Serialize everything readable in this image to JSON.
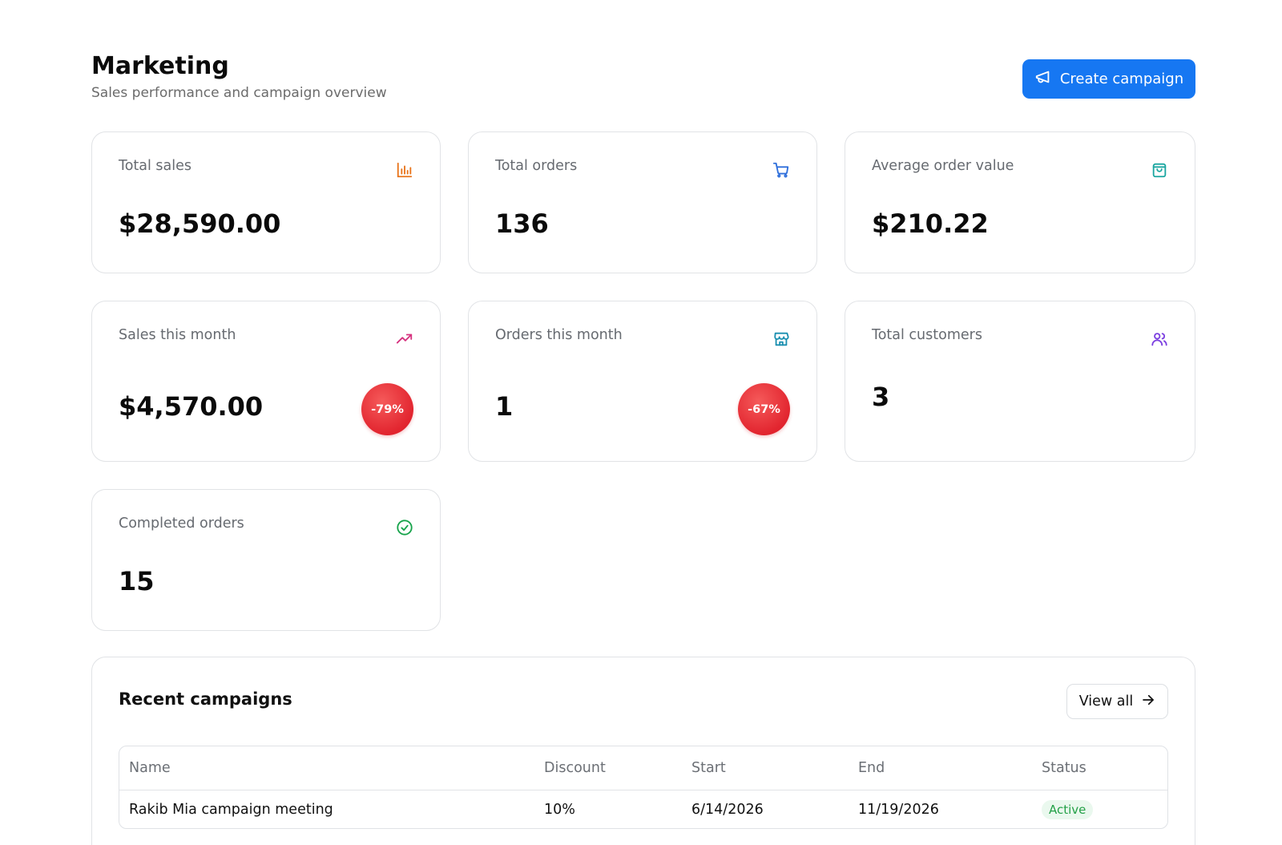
{
  "header": {
    "title": "Marketing",
    "subtitle": "Sales performance and campaign overview",
    "create_button_label": "Create campaign"
  },
  "stats": {
    "total_sales": {
      "label": "Total sales",
      "value": "$28,590.00",
      "icon": "bar-chart-icon",
      "icon_color": "#e8731a"
    },
    "total_orders": {
      "label": "Total orders",
      "value": "136",
      "icon": "shopping-cart-icon",
      "icon_color": "#2f6fdb"
    },
    "avg_order_value": {
      "label": "Average order value",
      "value": "$210.22",
      "icon": "shopping-bag-icon",
      "icon_color": "#1aa6a0"
    },
    "sales_this_month": {
      "label": "Sales this month",
      "value": "$4,570.00",
      "change": "-79%",
      "icon": "trending-up-icon",
      "icon_color": "#d6337f"
    },
    "orders_this_month": {
      "label": "Orders this month",
      "value": "1",
      "change": "-67%",
      "icon": "store-icon",
      "icon_color": "#1b8fb0"
    },
    "total_customers": {
      "label": "Total customers",
      "value": "3",
      "icon": "users-icon",
      "icon_color": "#7b3fe0"
    },
    "completed_orders": {
      "label": "Completed orders",
      "value": "15",
      "icon": "check-circle-icon",
      "icon_color": "#16a34a"
    }
  },
  "campaigns": {
    "title": "Recent campaigns",
    "view_all_label": "View all",
    "columns": [
      "Name",
      "Discount",
      "Start",
      "End",
      "Status"
    ],
    "rows": [
      {
        "name": "Rakib Mia campaign meeting",
        "discount": "10%",
        "start": "6/14/2026",
        "end": "11/19/2026",
        "status": "Active"
      }
    ]
  },
  "colors": {
    "primary": "#1677f2",
    "badge_red": "#e2252f",
    "status_active": "#23a047"
  }
}
